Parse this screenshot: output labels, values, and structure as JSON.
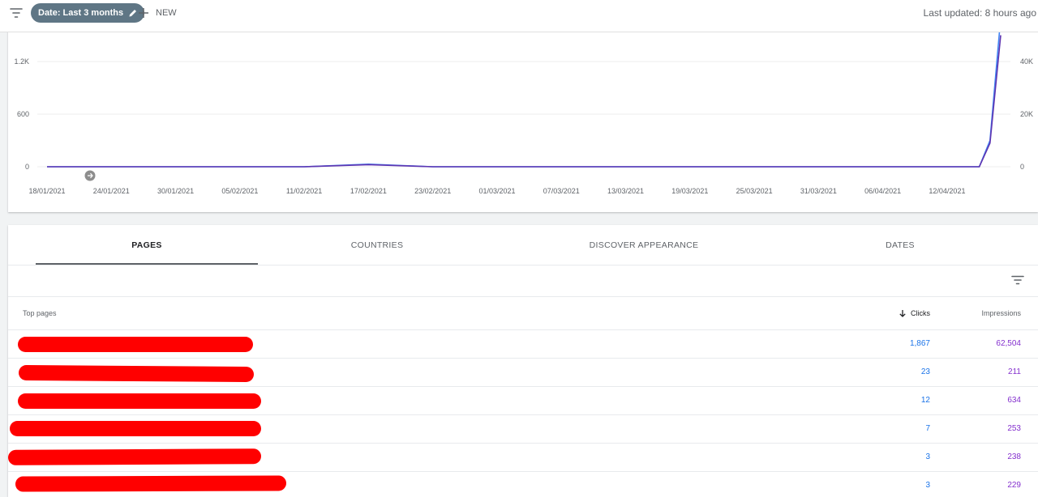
{
  "topbar": {
    "date_filter_label": "Date: Last 3 months",
    "new_label": "NEW",
    "last_updated": "Last updated: 8 hours ago"
  },
  "chart_data": {
    "type": "line",
    "x": [
      "18/01/2021",
      "24/01/2021",
      "30/01/2021",
      "05/02/2021",
      "11/02/2021",
      "17/02/2021",
      "23/02/2021",
      "01/03/2021",
      "07/03/2021",
      "13/03/2021",
      "19/03/2021",
      "25/03/2021",
      "31/03/2021",
      "06/04/2021",
      "12/04/2021",
      "15/04/2021",
      "16/04/2021",
      "17/04/2021"
    ],
    "x_tick_labels": [
      "18/01/2021",
      "24/01/2021",
      "30/01/2021",
      "05/02/2021",
      "11/02/2021",
      "17/02/2021",
      "23/02/2021",
      "01/03/2021",
      "07/03/2021",
      "13/03/2021",
      "19/03/2021",
      "25/03/2021",
      "31/03/2021",
      "06/04/2021",
      "12/04/2021"
    ],
    "series": [
      {
        "values": [
          0,
          0,
          0,
          0,
          0,
          30,
          0,
          0,
          0,
          0,
          0,
          0,
          0,
          0,
          0,
          0,
          300,
          1700
        ],
        "axis": "left",
        "color": "#4285f4"
      },
      {
        "values": [
          0,
          0,
          0,
          0,
          0,
          800,
          0,
          0,
          0,
          0,
          0,
          0,
          0,
          0,
          0,
          0,
          9000,
          50000
        ],
        "axis": "right",
        "color": "#5e35b1"
      }
    ],
    "left_ticks": [
      "0",
      "600",
      "1.2K"
    ],
    "right_ticks": [
      "0",
      "20K",
      "40K"
    ],
    "ylim_left": [
      0,
      1500
    ],
    "ylim_right": [
      0,
      50000
    ],
    "grid": true,
    "annotation_icon": "arrow-right-circle-icon"
  },
  "tabs": [
    {
      "label": "PAGES",
      "active": true
    },
    {
      "label": "COUNTRIES",
      "active": false
    },
    {
      "label": "DISCOVER APPEARANCE",
      "active": false
    },
    {
      "label": "DATES",
      "active": false
    }
  ],
  "table": {
    "headers": {
      "pages": "Top pages",
      "clicks": "Clicks",
      "impressions": "Impressions"
    },
    "rows": [
      {
        "clicks": "1,867",
        "impressions": "62,504"
      },
      {
        "clicks": "23",
        "impressions": "211"
      },
      {
        "clicks": "12",
        "impressions": "634"
      },
      {
        "clicks": "7",
        "impressions": "253"
      },
      {
        "clicks": "3",
        "impressions": "238"
      },
      {
        "clicks": "3",
        "impressions": "229"
      }
    ]
  },
  "colors": {
    "redaction": "#ff0000",
    "clicks": "#1a73e8",
    "impressions": "#8430ce",
    "chip": "#5f7685"
  },
  "icons": [
    "filter-icon",
    "pencil-icon",
    "plus-icon",
    "arrow-down-icon",
    "arrow-right-circle-icon"
  ]
}
